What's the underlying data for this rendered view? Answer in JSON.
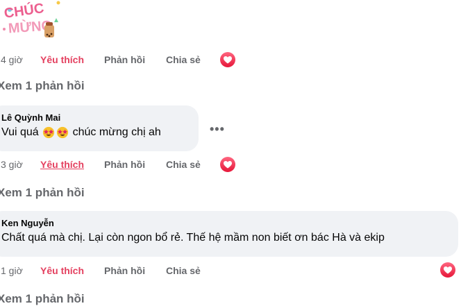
{
  "sticker": {
    "name": "chuc-mung-sticker",
    "text": "CHÚC MỪNG"
  },
  "comments": [
    {
      "time": "4 giờ",
      "like": "Yêu thích",
      "reply": "Phản hồi",
      "share": "Chia sẻ",
      "see_replies": "Xem 1 phản hồi"
    },
    {
      "author": "Lê Quỳnh Mai",
      "text_before": "Vui quá",
      "emoji": [
        "star-struck-emoji",
        "star-struck-emoji"
      ],
      "text_after": "chúc mừng chị ah",
      "more": "•••",
      "time": "3 giờ",
      "like": "Yêu thích",
      "reply": "Phản hồi",
      "share": "Chia sẻ",
      "see_replies": "Xem 1 phản hồi"
    },
    {
      "author": "Ken Nguyễn",
      "text": "Chất quá mà chị. Lại còn ngon bổ rẻ. Thế hệ mầm non biết ơn bác Hà và ekip",
      "time": "1 giờ",
      "like": "Yêu thích",
      "reply": "Phản hồi",
      "share": "Chia sẻ",
      "see_replies": "Xem 1 phản hồi"
    }
  ],
  "colors": {
    "like": "#e4405f",
    "muted": "#65676b",
    "bubble": "#f0f2f5",
    "heart": "#e61739"
  }
}
